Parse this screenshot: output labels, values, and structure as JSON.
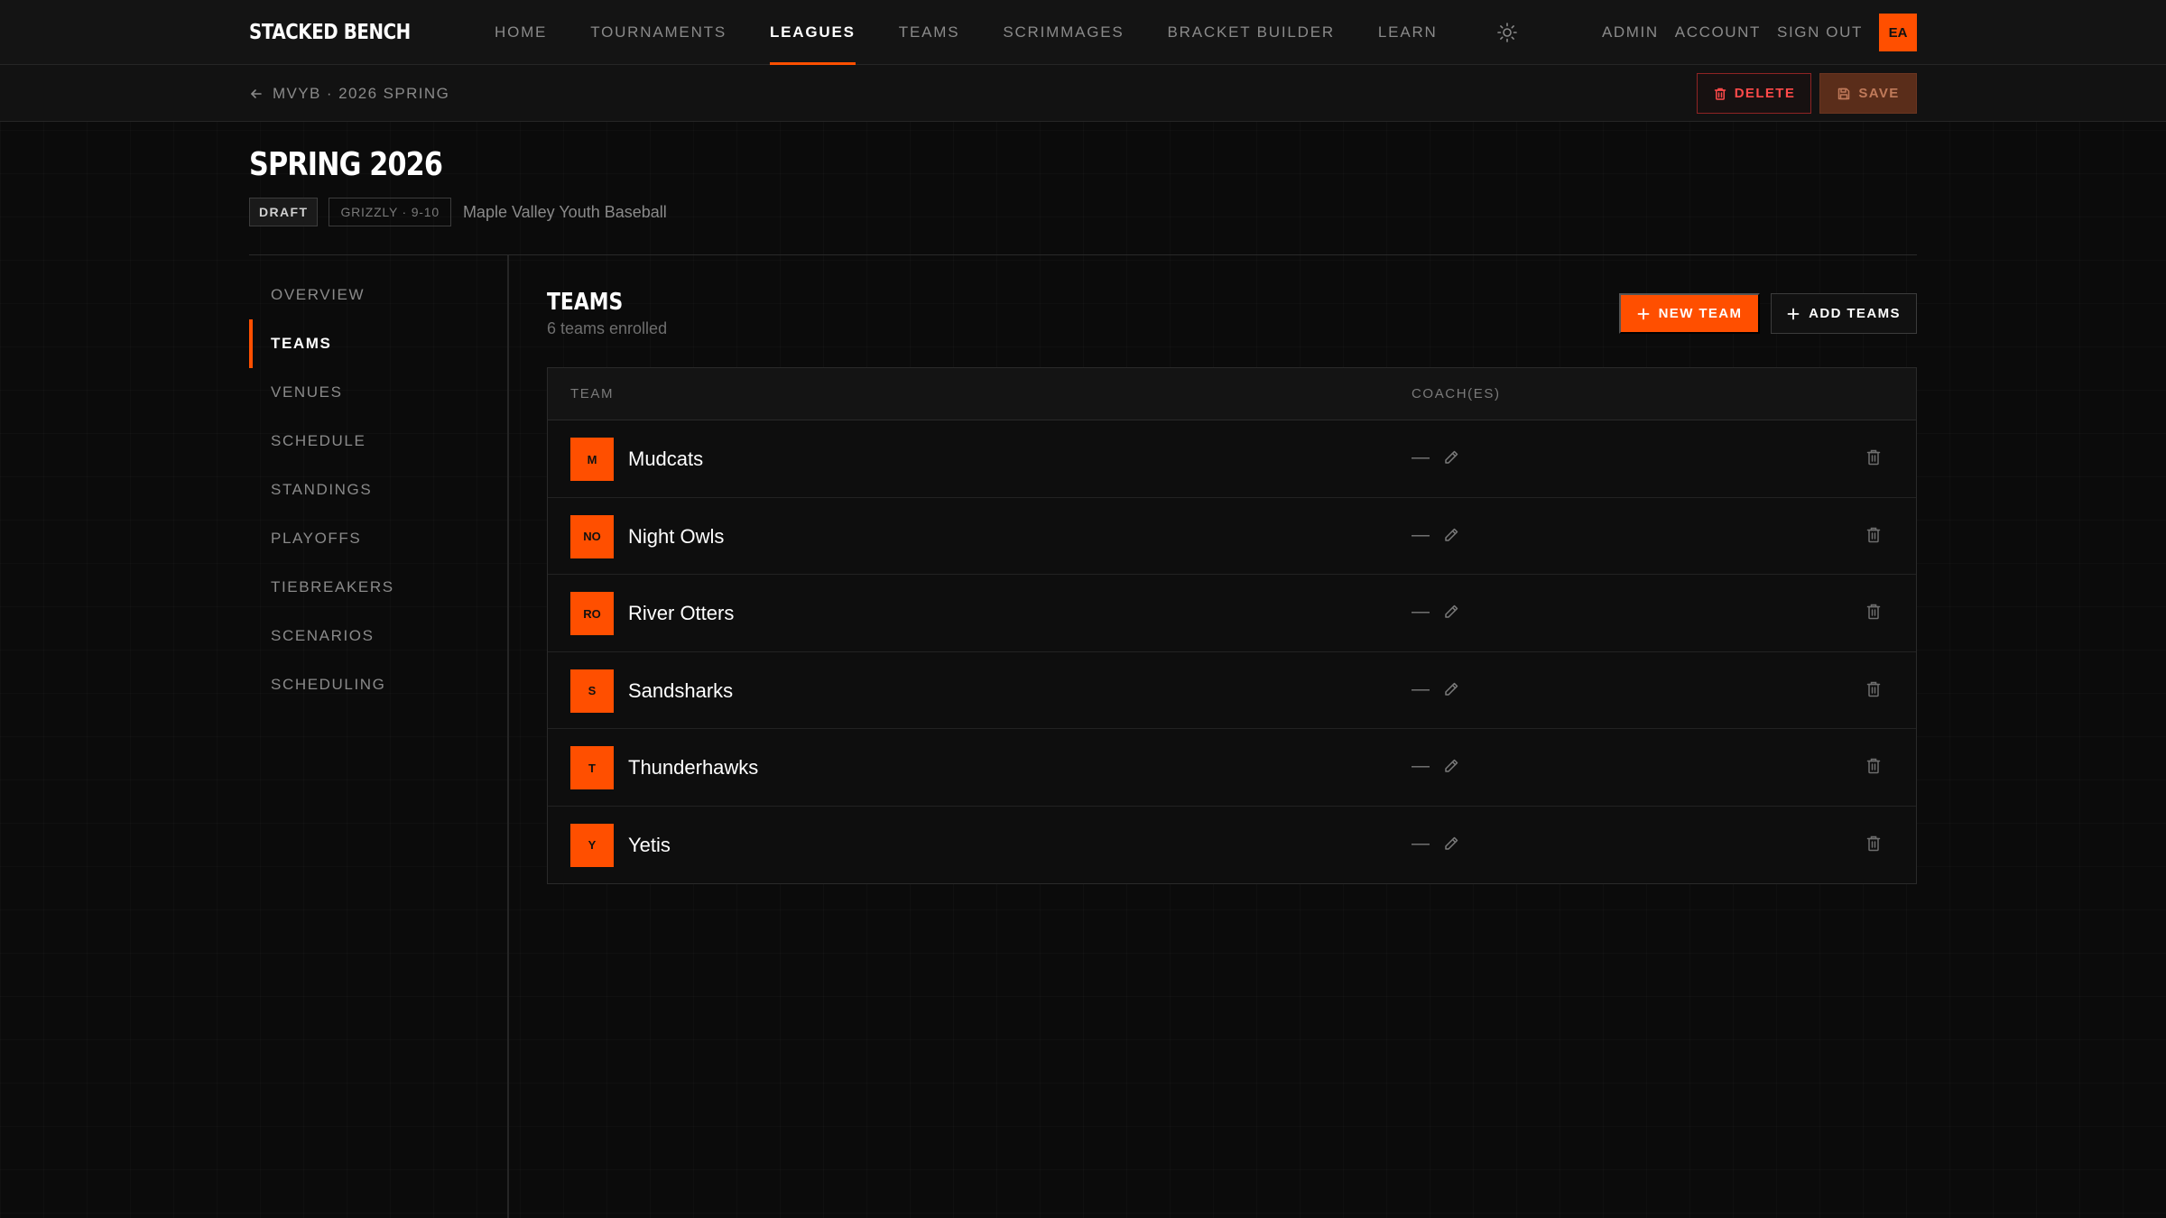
{
  "app": {
    "brand": "STACKED BENCH"
  },
  "nav": {
    "links": [
      {
        "label": "HOME"
      },
      {
        "label": "TOURNAMENTS"
      },
      {
        "label": "LEAGUES"
      },
      {
        "label": "TEAMS"
      },
      {
        "label": "SCRIMMAGES"
      },
      {
        "label": "BRACKET BUILDER"
      },
      {
        "label": "LEARN"
      }
    ],
    "active": "LEAGUES",
    "right": {
      "admin": "ADMIN",
      "account": "ACCOUNT",
      "sign_out": "SIGN OUT",
      "avatar_initials": "EA"
    }
  },
  "subbar": {
    "breadcrumb": "MVYB · 2026 SPRING",
    "delete_label": "DELETE",
    "save_label": "SAVE"
  },
  "header": {
    "title": "SPRING 2026",
    "status_badge": "DRAFT",
    "division_badge": "GRIZZLY · 9-10",
    "organization": "Maple Valley Youth Baseball"
  },
  "sidenav": {
    "items": [
      {
        "label": "OVERVIEW"
      },
      {
        "label": "TEAMS"
      },
      {
        "label": "VENUES"
      },
      {
        "label": "SCHEDULE"
      },
      {
        "label": "STANDINGS"
      },
      {
        "label": "PLAYOFFS"
      },
      {
        "label": "TIEBREAKERS"
      },
      {
        "label": "SCENARIOS"
      },
      {
        "label": "SCHEDULING"
      }
    ],
    "active": "TEAMS"
  },
  "teams": {
    "title": "TEAMS",
    "subtitle": "6 teams enrolled",
    "new_team_label": "NEW TEAM",
    "add_teams_label": "ADD TEAMS",
    "columns": {
      "team": "TEAM",
      "coaches": "COACH(ES)"
    },
    "rows": [
      {
        "initials": "M",
        "name": "Mudcats",
        "coach": "—"
      },
      {
        "initials": "NO",
        "name": "Night Owls",
        "coach": "—"
      },
      {
        "initials": "RO",
        "name": "River Otters",
        "coach": "—"
      },
      {
        "initials": "S",
        "name": "Sandsharks",
        "coach": "—"
      },
      {
        "initials": "T",
        "name": "Thunderhawks",
        "coach": "—"
      },
      {
        "initials": "Y",
        "name": "Yetis",
        "coach": "—"
      }
    ]
  },
  "colors": {
    "accent": "#ff4f00",
    "danger": "#ff4a4a",
    "background": "#0b0b0b"
  },
  "icons": {
    "theme": "sun-icon",
    "back": "arrow-left-icon",
    "delete": "trash-icon",
    "save": "floppy-disk-icon",
    "add": "plus-icon",
    "edit": "pencil-icon"
  }
}
